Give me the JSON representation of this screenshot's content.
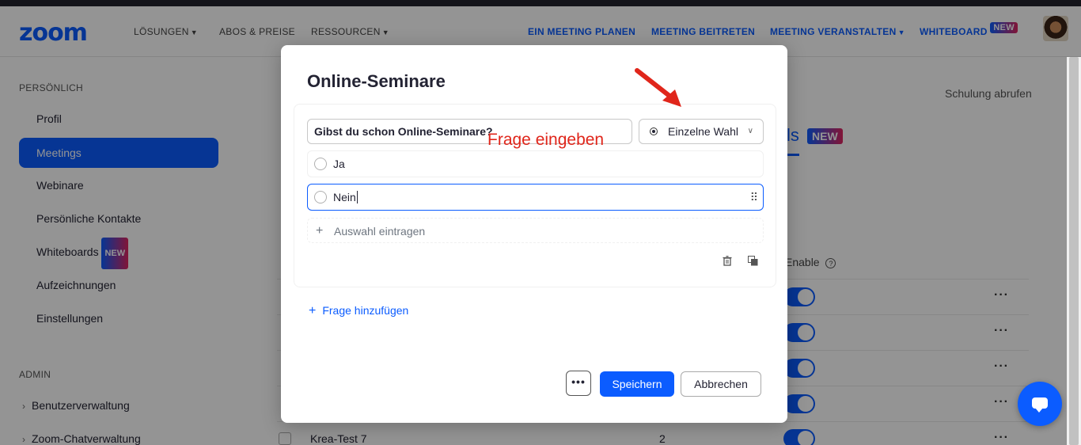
{
  "nav": {
    "logo": "zoom",
    "left_items": [
      "LÖSUNGEN",
      "ABOS & PREISE",
      "RESSOURCEN"
    ],
    "right_items": [
      "EIN MEETING PLANEN",
      "MEETING BEITRETEN",
      "MEETING VERANSTALTEN",
      "WHITEBOARD"
    ],
    "new_badge": "NEW"
  },
  "sidebar": {
    "personal_header": "PERSÖNLICH",
    "items": [
      "Profil",
      "Meetings",
      "Webinare",
      "Persönliche Kontakte",
      "Whiteboards",
      "Aufzeichnungen",
      "Einstellungen"
    ],
    "active": "Meetings",
    "whiteboards_badge": "NEW",
    "admin_header": "ADMIN",
    "admin_items": [
      "Benutzerverwaltung",
      "Zoom-Chatverwaltung"
    ]
  },
  "main": {
    "training_link": "Schulung abrufen",
    "tab_partial": "ls",
    "tab_badge": "NEW",
    "enable_col": "Enable",
    "last_row_name": "Krea-Test 7",
    "last_row_count": "2"
  },
  "modal": {
    "title": "Online-Seminare",
    "question_value": "Gibst du schon Online-Seminare?",
    "type_select": "Einzelne Wahl",
    "annotation": "Frage eingeben",
    "options": [
      "Ja",
      "Nein"
    ],
    "add_choice": "Auswahl eintragen",
    "add_question": "Frage hinzufügen",
    "save_button": "Speichern",
    "cancel_button": "Abbrechen",
    "more_button": "•••"
  },
  "colors": {
    "brand_blue": "#0b5cff",
    "annotation_red": "#e0261b"
  }
}
